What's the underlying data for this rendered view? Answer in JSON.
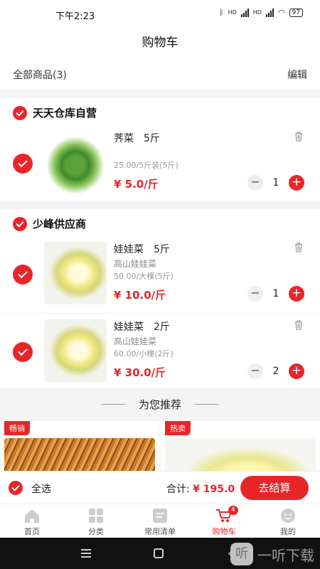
{
  "status": {
    "time": "下午2:23",
    "net1": "HD",
    "net2": "HD",
    "battery": "97"
  },
  "header": {
    "title": "购物车"
  },
  "subbar": {
    "all_label": "全部商品(3)",
    "edit_label": "编辑"
  },
  "shops": [
    {
      "name": "天天仓库自营",
      "items": [
        {
          "name": "荠菜",
          "weight": "5斤",
          "subtitle": "",
          "spec": "25.00/5斤装(5斤)",
          "price": "¥ 5.0/斤",
          "qty": "1"
        }
      ]
    },
    {
      "name": "少峰供应商",
      "items": [
        {
          "name": "娃娃菜",
          "weight": "5斤",
          "subtitle": "高山娃娃菜",
          "spec": "50.00/大棵(5斤)",
          "price": "¥ 10.0/斤",
          "qty": "1"
        },
        {
          "name": "娃娃菜",
          "weight": "2斤",
          "subtitle": "高山娃娃菜",
          "spec": "60.00/小棵(2斤)",
          "price": "¥ 30.0/斤",
          "qty": "2"
        }
      ]
    }
  ],
  "stepper": {
    "minus": "−",
    "plus": "+"
  },
  "recommend": {
    "title": "为您推荐",
    "cards": [
      {
        "tag": "畅销"
      },
      {
        "tag": "热卖"
      }
    ]
  },
  "checkout": {
    "select_all": "全选",
    "total_label": "合计:",
    "total_value": "¥ 195.0",
    "pay_label": "去结算"
  },
  "tabs": [
    {
      "label": "首页"
    },
    {
      "label": "分类"
    },
    {
      "label": "常用清单"
    },
    {
      "label": "购物车",
      "badge": "4"
    },
    {
      "label": "我的"
    }
  ],
  "watermark": {
    "logo": "听",
    "text": "一听下载"
  },
  "colors": {
    "accent": "#e8262a"
  }
}
